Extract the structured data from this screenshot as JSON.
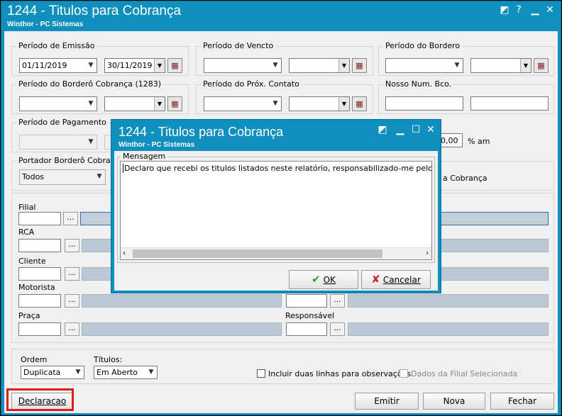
{
  "window": {
    "title": "1244 - Titulos para Cobrança",
    "subtitle": "Winthor - PC Sistemas"
  },
  "periodo_emissao": {
    "label": "Período de Emissão",
    "start": "01/11/2019",
    "end": "30/11/2019"
  },
  "periodo_vencto": {
    "label": "Período de Vencto",
    "start": "",
    "end": ""
  },
  "periodo_bordero": {
    "label": "Período do Bordero",
    "start": "",
    "end": ""
  },
  "periodo_bordero_cobranca": {
    "label": "Período do Borderô Cobrança (1283)",
    "start": "",
    "end": ""
  },
  "periodo_prox_contato": {
    "label": "Período do Próx. Contato",
    "start": "",
    "end": ""
  },
  "nosso_num": {
    "label": "Nosso Num. Bco.",
    "start": "",
    "end": ""
  },
  "periodo_pagamento": {
    "label": "Período de Pagamento",
    "start": "",
    "end": ""
  },
  "juros": {
    "value": "0,00",
    "unit": "% am"
  },
  "portador": {
    "label": "Portador Borderô Cobrança",
    "value": "Todos",
    "extra_label": "a Cobrança"
  },
  "filters": {
    "filial": "Filial",
    "rca": "RCA",
    "cliente": "Cliente",
    "motorista": "Motorista",
    "praca": "Praça",
    "responsavel": "Responsável",
    "dots": "..."
  },
  "ordem": {
    "label": "Ordem",
    "value": "Duplicata"
  },
  "titulos": {
    "label": "Títulos:",
    "value": "Em Aberto"
  },
  "checks": {
    "duas_linhas": "Incluir duas linhas para observações",
    "filial_sel": "Dados da Filial Selecionada"
  },
  "buttons": {
    "declaracao": "Declaracao",
    "emitir": "Emitir",
    "nova": "Nova",
    "fechar": "Fechar"
  },
  "dialog": {
    "title": "1244 - Titulos para Cobrança",
    "subtitle": "Winthor - PC Sistemas",
    "group_label": "Mensagem",
    "message": "Declaro que recebi os titulos listados neste relatório, responsabilizado-me pelo recebimento",
    "ok": "OK",
    "cancel": "Cancelar"
  },
  "colors": {
    "titlebar": "#0f8fbe",
    "highlight": "#e01b1b",
    "ok_icon": "#2e9e2e",
    "cancel_icon": "#c62828"
  }
}
